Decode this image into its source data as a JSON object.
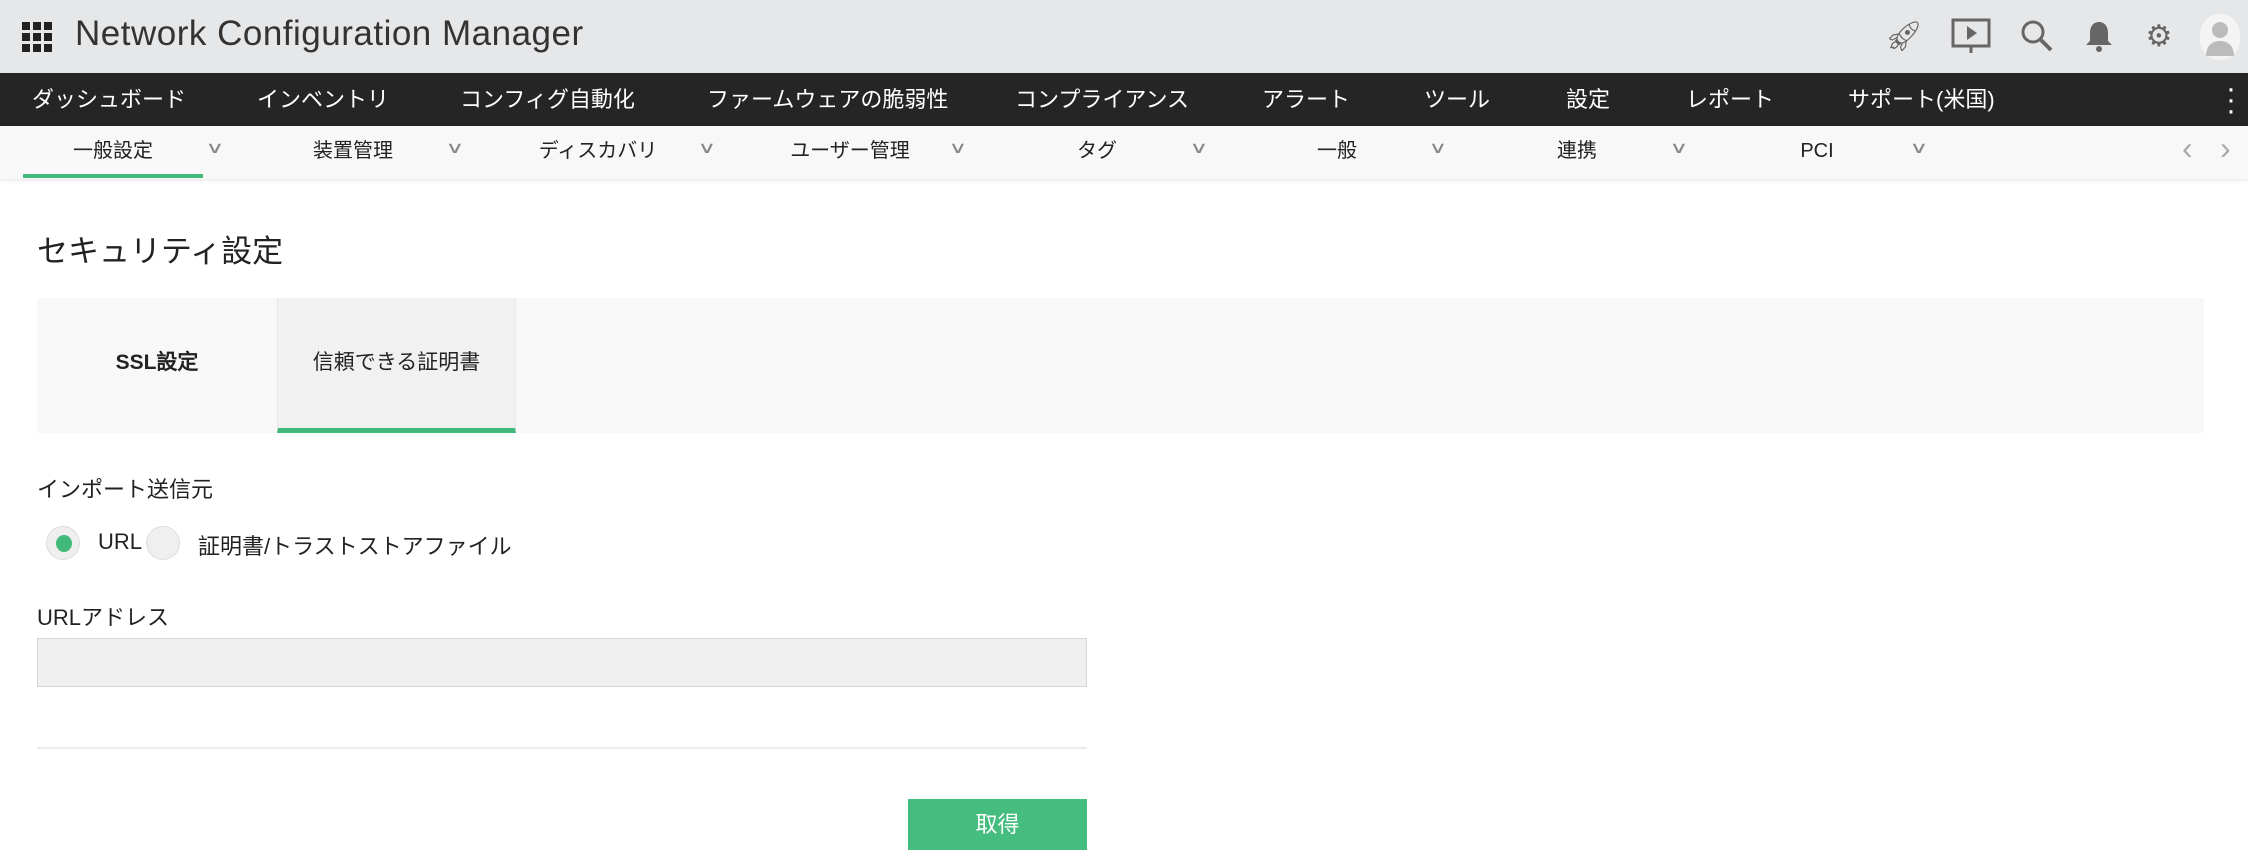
{
  "header": {
    "title": "Network Configuration Manager",
    "icons": [
      "apps-grid-icon",
      "rocket-icon",
      "presentation-icon",
      "search-icon",
      "bell-icon",
      "gear-icon",
      "avatar-icon"
    ]
  },
  "main_nav": [
    "ダッシュボード",
    "インベントリ",
    "コンフィグ自動化",
    "ファームウェアの脆弱性",
    "コンプライアンス",
    "アラート",
    "ツール",
    "設定",
    "レポート",
    "サポート(米国)"
  ],
  "sub_nav": [
    "一般設定",
    "装置管理",
    "ディスカバリ",
    "ユーザー管理",
    "タグ",
    "一般",
    "連携",
    "PCI"
  ],
  "page": {
    "title": "セキュリティ設定",
    "tabs": [
      "SSL設定",
      "信頼できる証明書"
    ],
    "active_tab": "信頼できる証明書",
    "import_label": "インポート送信元",
    "radio_options": [
      "URL",
      "証明書/トラストストアファイル"
    ],
    "selected": "URL",
    "url_label": "URLアドレス",
    "url_value": "",
    "fetch_button": "取得"
  },
  "colors": {
    "accent": "#41b97a",
    "nav_bg": "#252525",
    "topbar_bg": "#e6e7e9"
  }
}
